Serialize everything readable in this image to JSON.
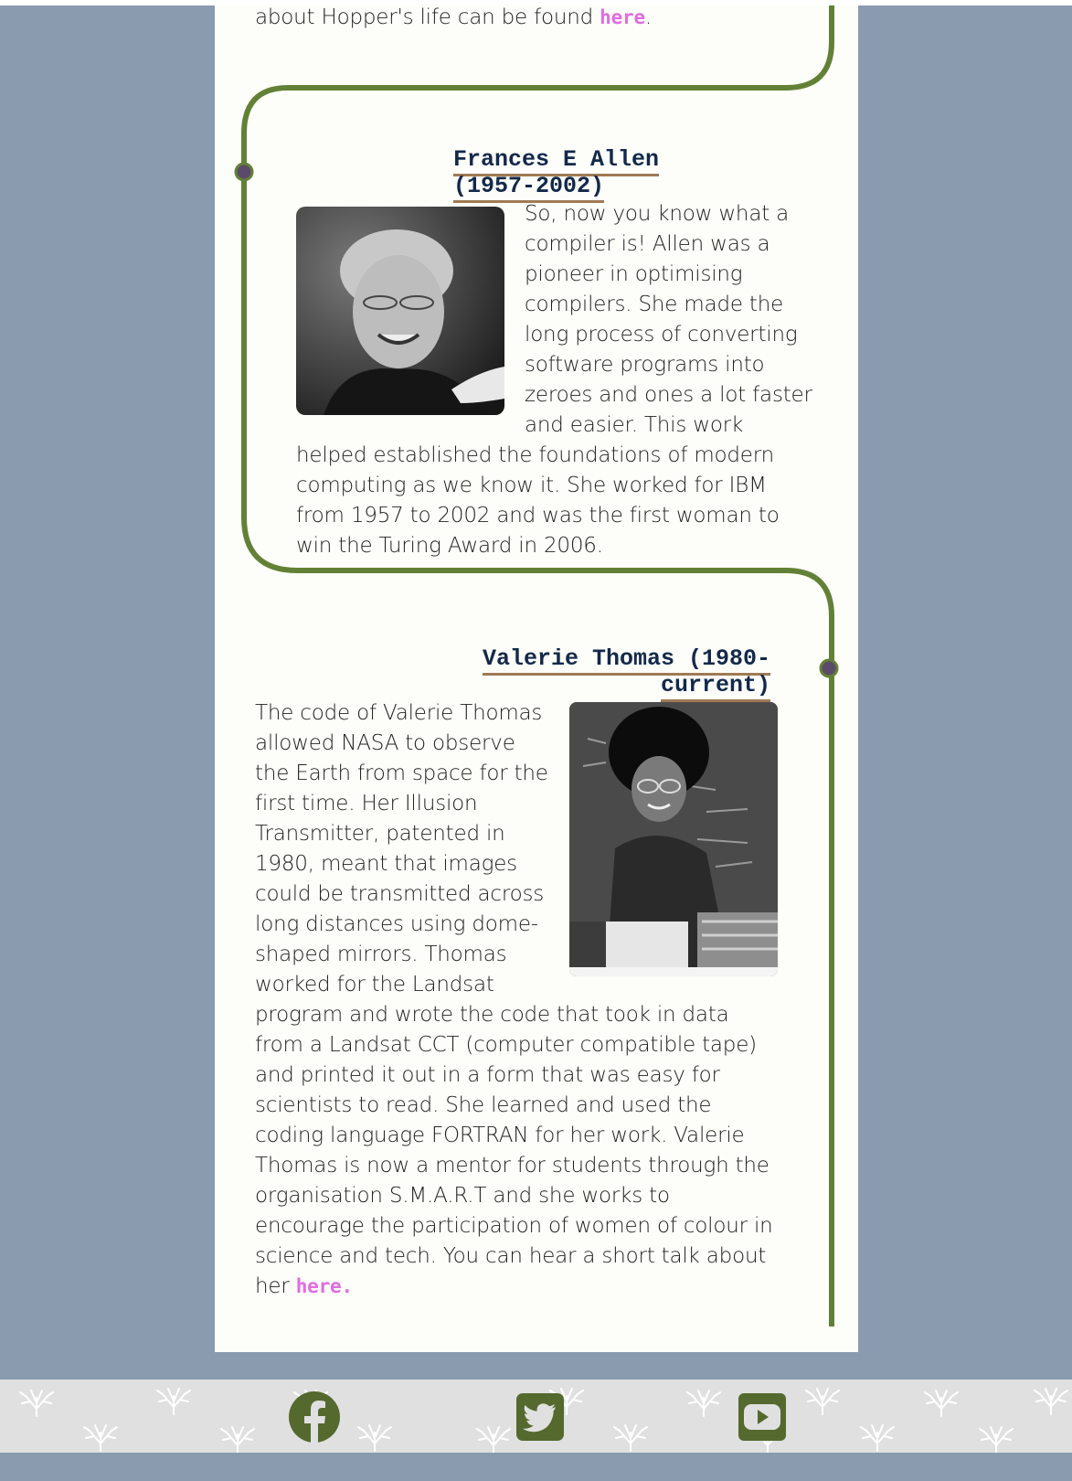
{
  "intro_tail": {
    "text": "about Hopper's life can be found ",
    "link_label": "here",
    "after": "."
  },
  "allen": {
    "heading_line1": "Frances E Allen",
    "heading_line2": "(1957-2002)",
    "body": "So, now you know what a compiler is! Allen was a pioneer in optimising compilers. She made the long process of converting software programs into zeroes and ones a lot faster and easier. This work helped established the foundations of modern computing as we know it. She worked for IBM from 1957 to 2002 and was the first woman to win the Turing Award in 2006."
  },
  "thomas": {
    "heading_line1": "Valerie Thomas (1980-",
    "heading_line2": "current)",
    "body": "The code of Valerie Thomas allowed NASA to observe the Earth from space for the first time. Her Illusion Transmitter, patented in 1980, meant that images could be transmitted across long distances using dome-shaped mirrors. Thomas worked for the Landsat program and wrote the code that took in data from a Landsat CCT (computer compatible tape) and printed it out in a form that was easy for scientists to read. She learned and used the coding language FORTRAN for her work. Valerie Thomas is now a mentor for students through the organisation S.M.A.R.T and she works to encourage the participation of women of colour in science and tech. You can hear a short talk about her ",
    "link_label": "here."
  },
  "footer": {
    "icons": [
      "facebook-icon",
      "twitter-icon",
      "youtube-icon"
    ]
  },
  "colors": {
    "page_bg": "#8a9bb0",
    "card_bg": "#fdfdf9",
    "timeline": "#628136",
    "timeline_dot": "#5b4a6a",
    "heading": "#13294b",
    "heading_underline": "#a07a55",
    "link": "#e06de0",
    "footer_bg": "#e0e0e0",
    "social": "#55692e"
  }
}
